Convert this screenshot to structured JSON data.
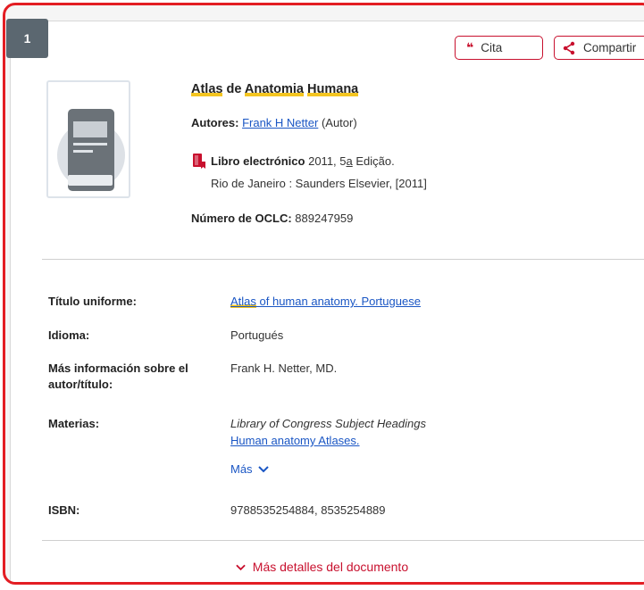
{
  "record": {
    "number": "1",
    "actions": {
      "cite": "Cita",
      "share": "Compartir"
    },
    "title_parts": [
      "Atlas",
      " de ",
      "Anatomia",
      " ",
      "Humana"
    ],
    "authors_label": "Autores:",
    "author_name": "Frank H Netter",
    "author_role": "(Autor)",
    "format_label": "Libro electrónico",
    "edition_pre": "2011, 5",
    "edition_a": "a",
    "edition_post": " Edição.",
    "publisher": "Rio de Janeiro : Saunders Elsevier, [2011]",
    "oclc_label": "Número de OCLC:",
    "oclc_value": "889247959"
  },
  "details": {
    "uniform_title_label": "Título uniforme:",
    "uniform_title_word": "Atlas",
    "uniform_title_rest": " of human anatomy. Portuguese",
    "language_label": "Idioma:",
    "language_value": "Portugués",
    "more_info_label_1": "Más información sobre el",
    "more_info_label_2": "autor/título:",
    "more_info_value": "Frank H. Netter, MD.",
    "subjects_label": "Materias:",
    "subjects_source": "Library of Congress Subject Headings",
    "subjects_heading": "Human anatomy Atlases.",
    "subjects_more": "Más",
    "isbn_label": "ISBN:",
    "isbn_value": "9788535254884, 8535254889"
  },
  "footer": {
    "more_details": "Más detalles del documento"
  },
  "colors": {
    "accent": "#c8102e",
    "link": "#1a56c4",
    "highlight": "#f4c520",
    "border": "#e31d23"
  }
}
